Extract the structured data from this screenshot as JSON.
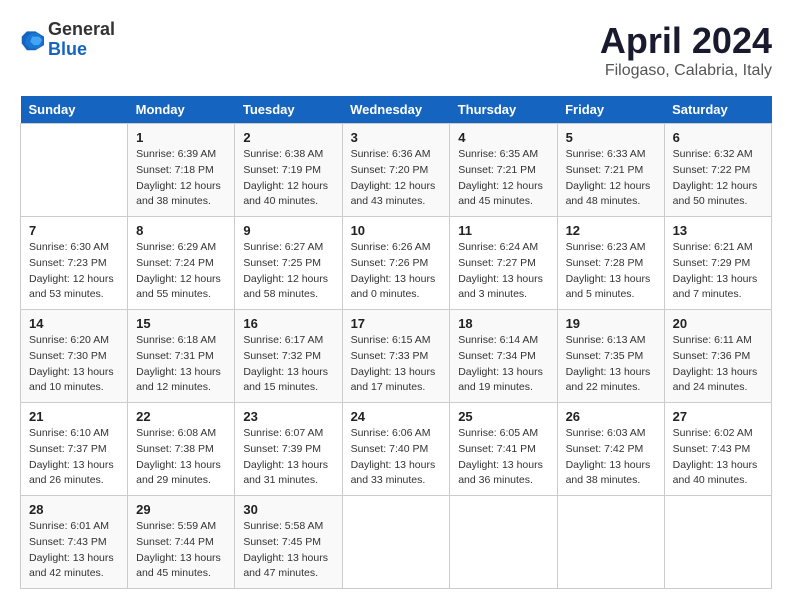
{
  "header": {
    "logo_general": "General",
    "logo_blue": "Blue",
    "title": "April 2024",
    "subtitle": "Filogaso, Calabria, Italy"
  },
  "weekdays": [
    "Sunday",
    "Monday",
    "Tuesday",
    "Wednesday",
    "Thursday",
    "Friday",
    "Saturday"
  ],
  "weeks": [
    [
      {
        "day": "",
        "sunrise": "",
        "sunset": "",
        "daylight": ""
      },
      {
        "day": "1",
        "sunrise": "Sunrise: 6:39 AM",
        "sunset": "Sunset: 7:18 PM",
        "daylight": "Daylight: 12 hours and 38 minutes."
      },
      {
        "day": "2",
        "sunrise": "Sunrise: 6:38 AM",
        "sunset": "Sunset: 7:19 PM",
        "daylight": "Daylight: 12 hours and 40 minutes."
      },
      {
        "day": "3",
        "sunrise": "Sunrise: 6:36 AM",
        "sunset": "Sunset: 7:20 PM",
        "daylight": "Daylight: 12 hours and 43 minutes."
      },
      {
        "day": "4",
        "sunrise": "Sunrise: 6:35 AM",
        "sunset": "Sunset: 7:21 PM",
        "daylight": "Daylight: 12 hours and 45 minutes."
      },
      {
        "day": "5",
        "sunrise": "Sunrise: 6:33 AM",
        "sunset": "Sunset: 7:21 PM",
        "daylight": "Daylight: 12 hours and 48 minutes."
      },
      {
        "day": "6",
        "sunrise": "Sunrise: 6:32 AM",
        "sunset": "Sunset: 7:22 PM",
        "daylight": "Daylight: 12 hours and 50 minutes."
      }
    ],
    [
      {
        "day": "7",
        "sunrise": "Sunrise: 6:30 AM",
        "sunset": "Sunset: 7:23 PM",
        "daylight": "Daylight: 12 hours and 53 minutes."
      },
      {
        "day": "8",
        "sunrise": "Sunrise: 6:29 AM",
        "sunset": "Sunset: 7:24 PM",
        "daylight": "Daylight: 12 hours and 55 minutes."
      },
      {
        "day": "9",
        "sunrise": "Sunrise: 6:27 AM",
        "sunset": "Sunset: 7:25 PM",
        "daylight": "Daylight: 12 hours and 58 minutes."
      },
      {
        "day": "10",
        "sunrise": "Sunrise: 6:26 AM",
        "sunset": "Sunset: 7:26 PM",
        "daylight": "Daylight: 13 hours and 0 minutes."
      },
      {
        "day": "11",
        "sunrise": "Sunrise: 6:24 AM",
        "sunset": "Sunset: 7:27 PM",
        "daylight": "Daylight: 13 hours and 3 minutes."
      },
      {
        "day": "12",
        "sunrise": "Sunrise: 6:23 AM",
        "sunset": "Sunset: 7:28 PM",
        "daylight": "Daylight: 13 hours and 5 minutes."
      },
      {
        "day": "13",
        "sunrise": "Sunrise: 6:21 AM",
        "sunset": "Sunset: 7:29 PM",
        "daylight": "Daylight: 13 hours and 7 minutes."
      }
    ],
    [
      {
        "day": "14",
        "sunrise": "Sunrise: 6:20 AM",
        "sunset": "Sunset: 7:30 PM",
        "daylight": "Daylight: 13 hours and 10 minutes."
      },
      {
        "day": "15",
        "sunrise": "Sunrise: 6:18 AM",
        "sunset": "Sunset: 7:31 PM",
        "daylight": "Daylight: 13 hours and 12 minutes."
      },
      {
        "day": "16",
        "sunrise": "Sunrise: 6:17 AM",
        "sunset": "Sunset: 7:32 PM",
        "daylight": "Daylight: 13 hours and 15 minutes."
      },
      {
        "day": "17",
        "sunrise": "Sunrise: 6:15 AM",
        "sunset": "Sunset: 7:33 PM",
        "daylight": "Daylight: 13 hours and 17 minutes."
      },
      {
        "day": "18",
        "sunrise": "Sunrise: 6:14 AM",
        "sunset": "Sunset: 7:34 PM",
        "daylight": "Daylight: 13 hours and 19 minutes."
      },
      {
        "day": "19",
        "sunrise": "Sunrise: 6:13 AM",
        "sunset": "Sunset: 7:35 PM",
        "daylight": "Daylight: 13 hours and 22 minutes."
      },
      {
        "day": "20",
        "sunrise": "Sunrise: 6:11 AM",
        "sunset": "Sunset: 7:36 PM",
        "daylight": "Daylight: 13 hours and 24 minutes."
      }
    ],
    [
      {
        "day": "21",
        "sunrise": "Sunrise: 6:10 AM",
        "sunset": "Sunset: 7:37 PM",
        "daylight": "Daylight: 13 hours and 26 minutes."
      },
      {
        "day": "22",
        "sunrise": "Sunrise: 6:08 AM",
        "sunset": "Sunset: 7:38 PM",
        "daylight": "Daylight: 13 hours and 29 minutes."
      },
      {
        "day": "23",
        "sunrise": "Sunrise: 6:07 AM",
        "sunset": "Sunset: 7:39 PM",
        "daylight": "Daylight: 13 hours and 31 minutes."
      },
      {
        "day": "24",
        "sunrise": "Sunrise: 6:06 AM",
        "sunset": "Sunset: 7:40 PM",
        "daylight": "Daylight: 13 hours and 33 minutes."
      },
      {
        "day": "25",
        "sunrise": "Sunrise: 6:05 AM",
        "sunset": "Sunset: 7:41 PM",
        "daylight": "Daylight: 13 hours and 36 minutes."
      },
      {
        "day": "26",
        "sunrise": "Sunrise: 6:03 AM",
        "sunset": "Sunset: 7:42 PM",
        "daylight": "Daylight: 13 hours and 38 minutes."
      },
      {
        "day": "27",
        "sunrise": "Sunrise: 6:02 AM",
        "sunset": "Sunset: 7:43 PM",
        "daylight": "Daylight: 13 hours and 40 minutes."
      }
    ],
    [
      {
        "day": "28",
        "sunrise": "Sunrise: 6:01 AM",
        "sunset": "Sunset: 7:43 PM",
        "daylight": "Daylight: 13 hours and 42 minutes."
      },
      {
        "day": "29",
        "sunrise": "Sunrise: 5:59 AM",
        "sunset": "Sunset: 7:44 PM",
        "daylight": "Daylight: 13 hours and 45 minutes."
      },
      {
        "day": "30",
        "sunrise": "Sunrise: 5:58 AM",
        "sunset": "Sunset: 7:45 PM",
        "daylight": "Daylight: 13 hours and 47 minutes."
      },
      {
        "day": "",
        "sunrise": "",
        "sunset": "",
        "daylight": ""
      },
      {
        "day": "",
        "sunrise": "",
        "sunset": "",
        "daylight": ""
      },
      {
        "day": "",
        "sunrise": "",
        "sunset": "",
        "daylight": ""
      },
      {
        "day": "",
        "sunrise": "",
        "sunset": "",
        "daylight": ""
      }
    ]
  ]
}
